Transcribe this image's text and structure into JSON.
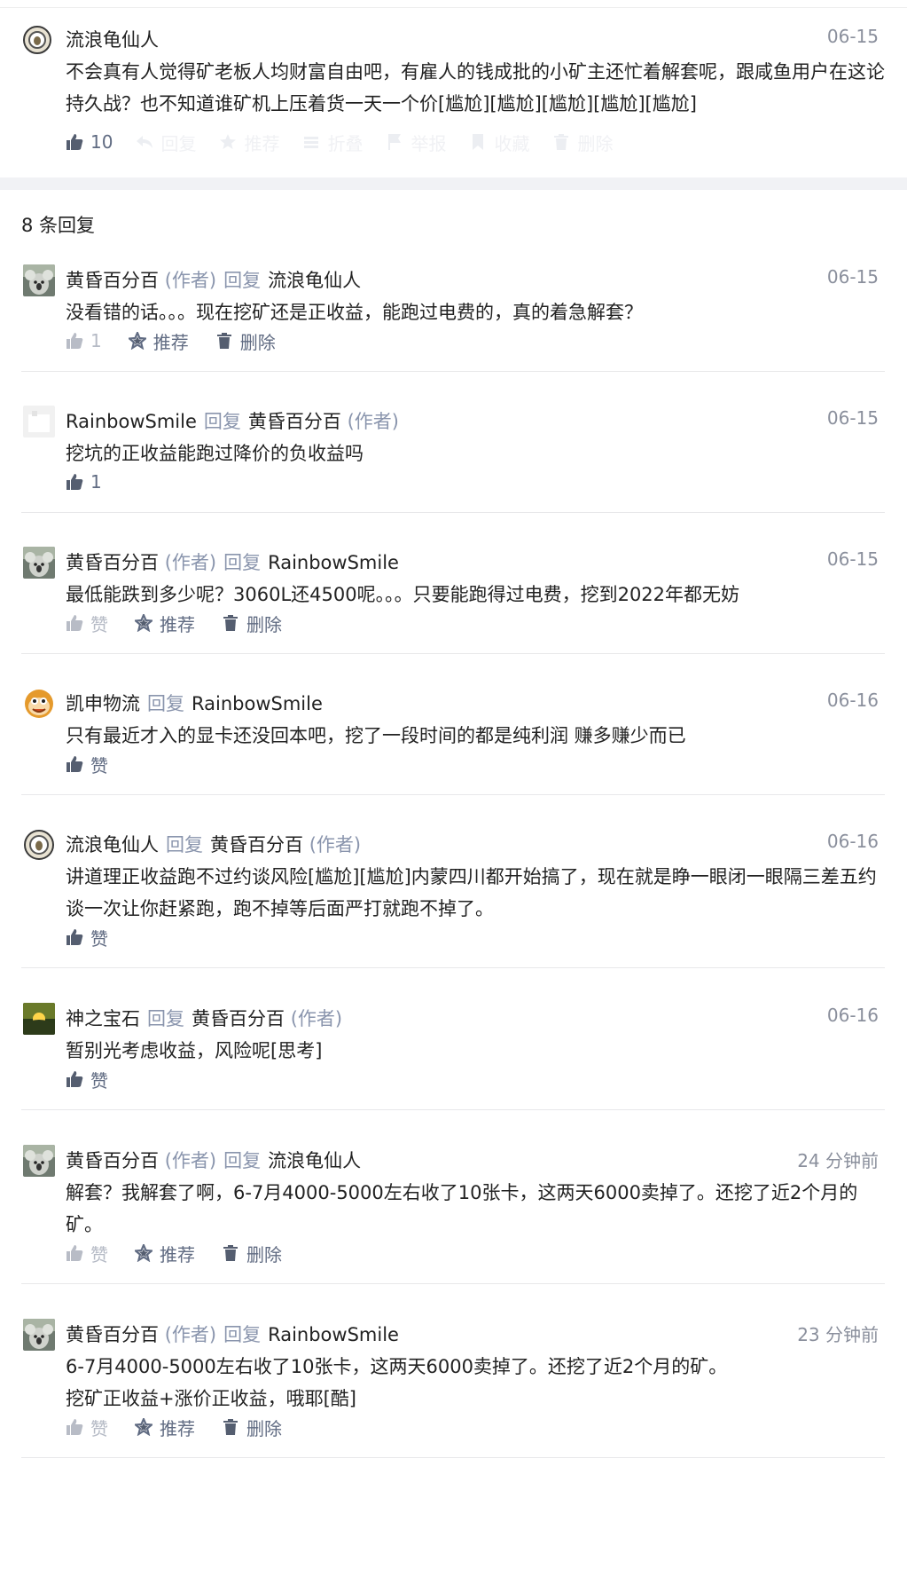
{
  "top_comment": {
    "user": "流浪龟仙人",
    "date": "06-15",
    "text": "不会真有人觉得矿老板人均财富自由吧，有雇人的钱成批的小矿主还忙着解套呢，跟咸鱼用户在这论持久战？也不知道谁矿机上压着货一天一个价[尴尬][尴尬][尴尬][尴尬][尴尬]",
    "likes": "10",
    "faded_actions": [
      "回复",
      "推荐",
      "折叠",
      "举报",
      "收藏",
      "删除"
    ]
  },
  "reply_count": "8 条回复",
  "labels": {
    "author": "(作者)",
    "reply": "回复"
  },
  "replies": [
    {
      "user": "黄昏百分百",
      "is_author": true,
      "target": "流浪龟仙人",
      "target_is_author": false,
      "date": "06-15",
      "text": "没看错的话。。。现在挖矿还是正收益，能跑过电费的，真的着急解套？",
      "like": "1",
      "recommend": "推荐",
      "delete": "删除",
      "avatar": "koala-avatar"
    },
    {
      "user": "RainbowSmile",
      "is_author": false,
      "target": "黄昏百分百",
      "target_is_author": true,
      "date": "06-15",
      "text": "挖坑的正收益能跑过降价的负收益吗",
      "like": "1",
      "avatar": "blank-avatar"
    },
    {
      "user": "黄昏百分百",
      "is_author": true,
      "target": "RainbowSmile",
      "target_is_author": false,
      "date": "06-15",
      "text": "最低能跌到多少呢？3060L还4500呢。。。只要能跑得过电费，挖到2022年都无妨",
      "like": "赞",
      "recommend": "推荐",
      "delete": "删除",
      "avatar": "koala-avatar"
    },
    {
      "user": "凯申物流",
      "is_author": false,
      "target": "RainbowSmile",
      "target_is_author": false,
      "date": "06-16",
      "text": "只有最近才入的显卡还没回本吧，挖了一段时间的都是纯利润 赚多赚少而已",
      "like": "赞",
      "avatar": "monkey-avatar"
    },
    {
      "user": "流浪龟仙人",
      "is_author": false,
      "target": "黄昏百分百",
      "target_is_author": true,
      "date": "06-16",
      "text": "讲道理正收益跑不过约谈风险[尴尬][尴尬]内蒙四川都开始搞了，现在就是睁一眼闭一眼隔三差五约谈一次让你赶紧跑，跑不掉等后面严打就跑不掉了。",
      "like": "赞",
      "avatar": "turtle-avatar"
    },
    {
      "user": "神之宝石",
      "is_author": false,
      "target": "黄昏百分百",
      "target_is_author": true,
      "date": "06-16",
      "text": "暂别光考虑收益，风险呢[思考]",
      "like": "赞",
      "avatar": "sunset-avatar"
    },
    {
      "user": "黄昏百分百",
      "is_author": true,
      "target": "流浪龟仙人",
      "target_is_author": false,
      "date": "24 分钟前",
      "text": "解套？我解套了啊，6-7月4000-5000左右收了10张卡，这两天6000卖掉了。还挖了近2个月的矿。",
      "like": "赞",
      "recommend": "推荐",
      "delete": "删除",
      "avatar": "koala-avatar"
    },
    {
      "user": "黄昏百分百",
      "is_author": true,
      "target": "RainbowSmile",
      "target_is_author": false,
      "date": "23 分钟前",
      "text": "6-7月4000-5000左右收了10张卡，这两天6000卖掉了。还挖了近2个月的矿。\n挖矿正收益+涨价正收益，哦耶[酷]",
      "like": "赞",
      "recommend": "推荐",
      "delete": "删除",
      "avatar": "koala-avatar"
    }
  ]
}
